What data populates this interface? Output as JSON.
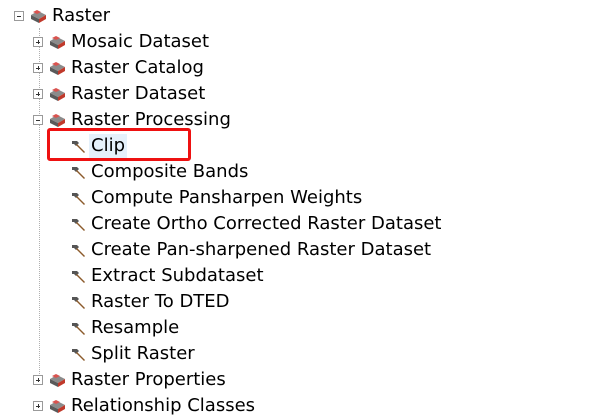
{
  "tree": {
    "root": {
      "label": "Raster",
      "expanded": true
    },
    "toolsets": [
      {
        "label": "Mosaic Dataset",
        "expanded": false
      },
      {
        "label": "Raster Catalog",
        "expanded": false
      },
      {
        "label": "Raster Dataset",
        "expanded": false
      },
      {
        "label": "Raster Processing",
        "expanded": true
      },
      {
        "label": "Raster Properties",
        "expanded": false
      },
      {
        "label": "Relationship Classes",
        "expanded": false
      }
    ],
    "tools": [
      {
        "label": "Clip",
        "selected": true
      },
      {
        "label": "Composite Bands"
      },
      {
        "label": "Compute Pansharpen Weights"
      },
      {
        "label": "Create Ortho Corrected Raster Dataset"
      },
      {
        "label": "Create Pan-sharpened Raster Dataset"
      },
      {
        "label": "Extract Subdataset"
      },
      {
        "label": "Raster To DTED"
      },
      {
        "label": "Resample"
      },
      {
        "label": "Split Raster"
      }
    ]
  },
  "icons": {
    "toolbox": "toolbox-icon",
    "tool": "hammer-icon",
    "collapse": "minus-box-icon",
    "expand": "plus-box-icon"
  },
  "colors": {
    "highlight": "#ee1111",
    "selection": "#e5f1fb"
  }
}
